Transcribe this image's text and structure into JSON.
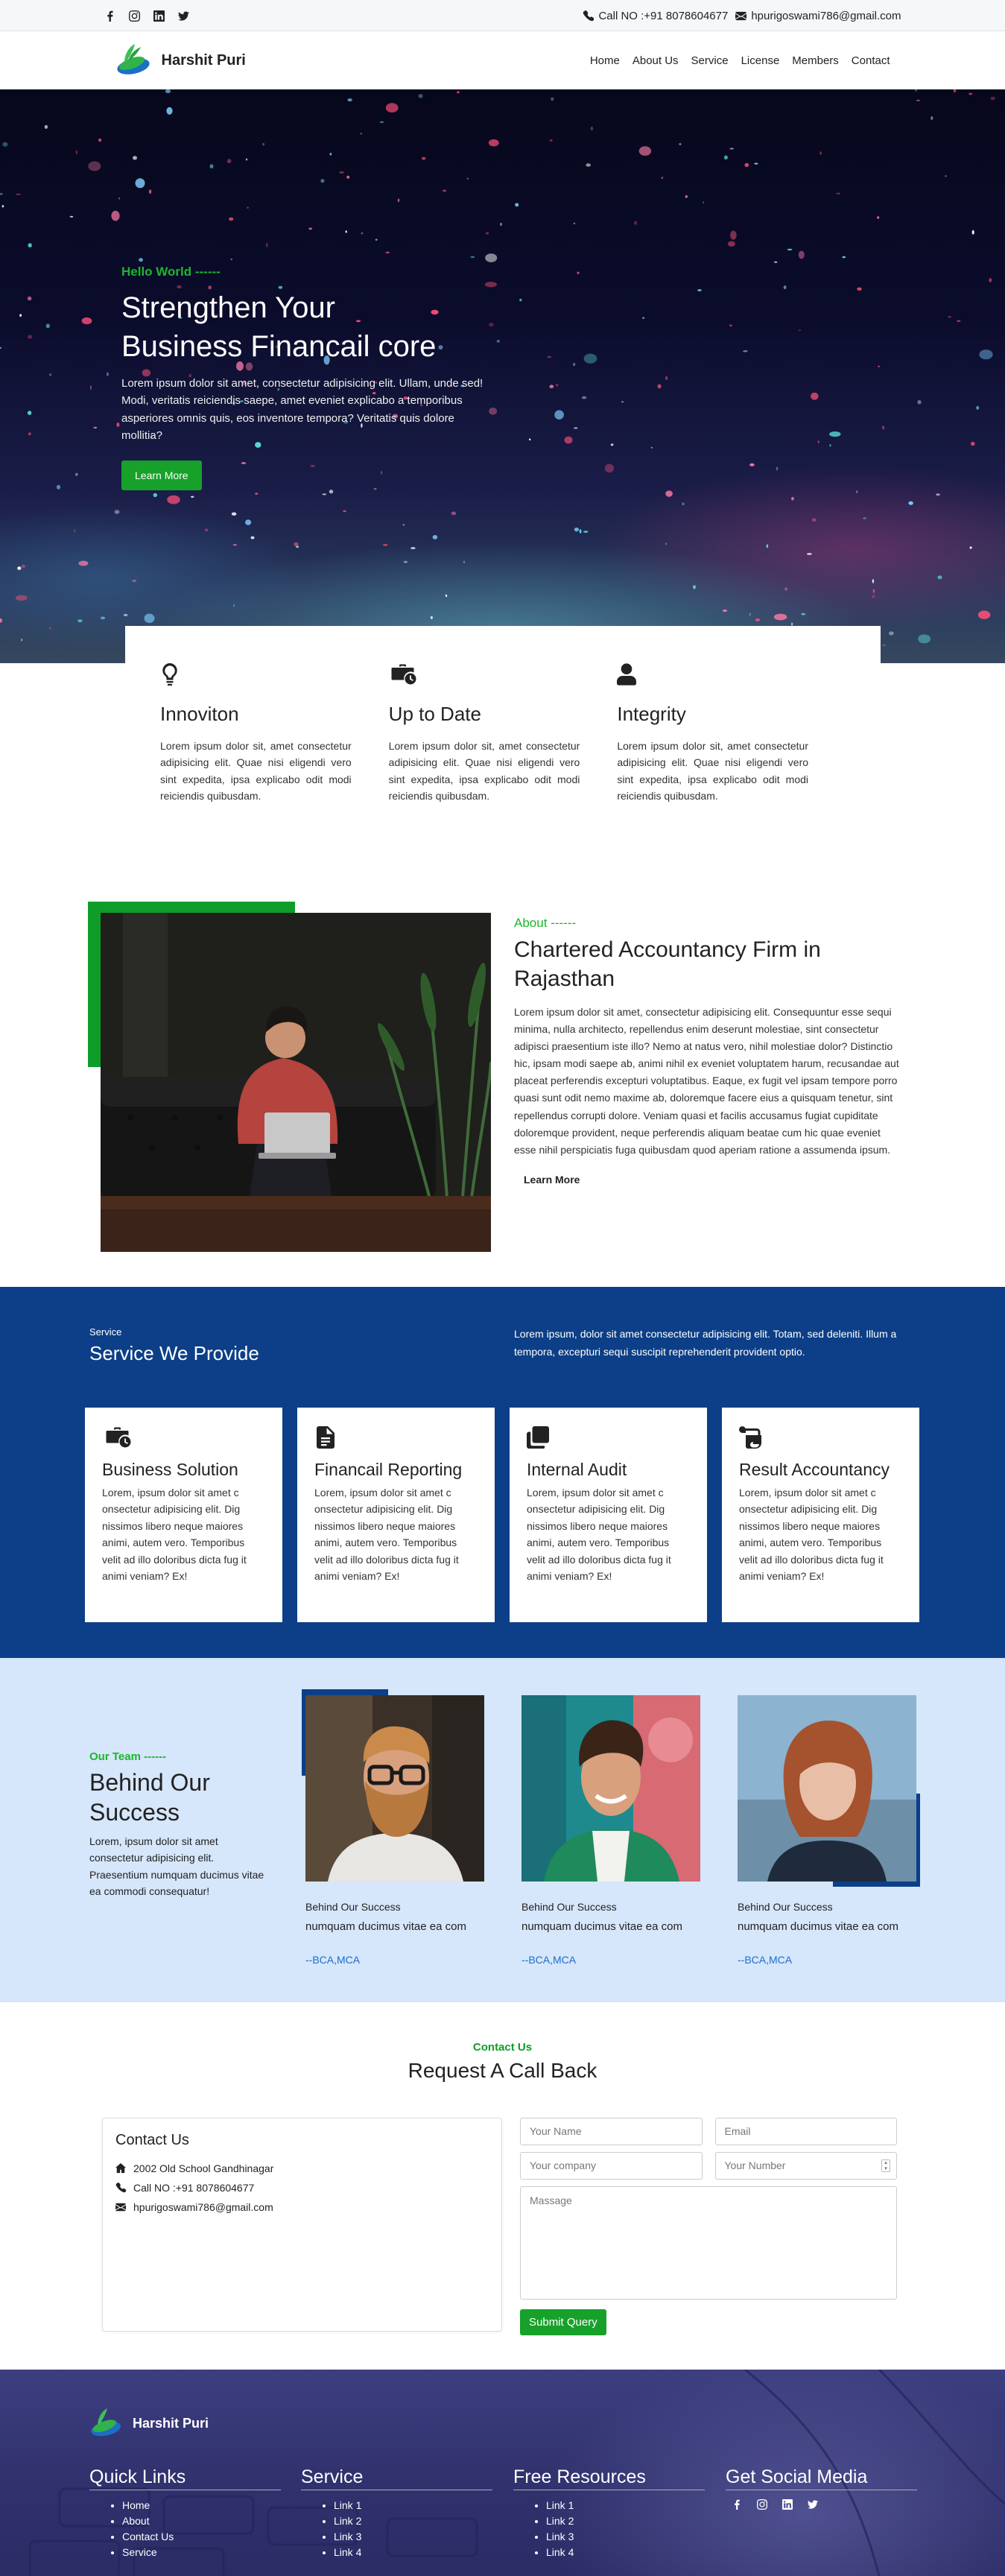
{
  "topbar": {
    "social_icons": [
      "facebook-icon",
      "instagram-icon",
      "linkedin-icon",
      "twitter-icon"
    ],
    "phone": "Call NO :+91 8078604677",
    "email": "hpurigoswami786@gmail.com"
  },
  "nav": {
    "brand": "Harshit Puri",
    "items": [
      "Home",
      "About Us",
      "Service",
      "License",
      "Members",
      "Contact"
    ]
  },
  "hero": {
    "eyebrow": "Hello World ------",
    "title_line1": "Strengthen Your",
    "title_line2": "Business Financail core",
    "text": "Lorem ipsum dolor sit amet, consectetur adipisicing elit. Ullam, unde sed! Modi, veritatis reiciendis saepe, amet eveniet explicabo a temporibus asperiores omnis quis, eos inventore tempora? Veritatis quis dolore mollitia?",
    "button": "Learn More"
  },
  "features": [
    {
      "icon": "lightbulb-icon",
      "title": "Innoviton",
      "text": "Lorem ipsum dolor sit, amet consectetur adipisicing elit. Quae nisi eligendi vero sint expedita, ipsa explicabo odit modi reiciendis quibusdam."
    },
    {
      "icon": "briefcase-clock-icon",
      "title": "Up to Date",
      "text": "Lorem ipsum dolor sit, amet consectetur adipisicing elit. Quae nisi eligendi vero sint expedita, ipsa explicabo odit modi reiciendis quibusdam."
    },
    {
      "icon": "user-icon",
      "title": "Integrity",
      "text": "Lorem ipsum dolor sit, amet consectetur adipisicing elit. Quae nisi eligendi vero sint expedita, ipsa explicabo odit modi reiciendis quibusdam."
    }
  ],
  "about": {
    "eyebrow": "About ------",
    "title": "Chartered Accountancy Firm in Rajasthan",
    "text": "Lorem ipsum dolor sit amet, consectetur adipisicing elit. Consequuntur esse sequi minima, nulla architecto, repellendus enim deserunt molestiae, sint consectetur adipisci praesentium iste illo? Nemo at natus vero, nihil molestiae dolor? Distinctio hic, ipsam modi saepe ab, animi nihil ex eveniet voluptatem harum, recusandae aut placeat perferendis excepturi voluptatibus. Eaque, ex fugit vel ipsam tempore porro quasi sunt odit nemo maxime ab, doloremque facere eius a quisquam tenetur, sint repellendus corrupti dolore. Veniam quasi et facilis accusamus fugiat cupiditate doloremque provident, neque perferendis aliquam beatae cum hic quae eveniet esse nihil perspiciatis fuga quibusdam quod aperiam ratione a assumenda ipsum.",
    "link": "Learn More"
  },
  "services": {
    "small": "Service",
    "title": "Service We Provide",
    "text": "Lorem ipsum, dolor sit amet consectetur adipisicing elit. Totam, sed deleniti. Illum a tempora, excepturi sequi suscipit reprehenderit provident optio.",
    "cards": [
      {
        "icon": "briefcase-clock-icon",
        "title": "Business Solution",
        "text": "Lorem, ipsum dolor sit amet c onsectetur adipisicing elit. Dig nissimos libero neque maiores animi, autem vero. Temporibus velit ad illo doloribus dicta fug it animi veniam? Ex!"
      },
      {
        "icon": "document-icon",
        "title": "Financail Reporting",
        "text": "Lorem, ipsum dolor sit amet c onsectetur adipisicing elit. Dig nissimos libero neque maiores animi, autem vero. Temporibus velit ad illo doloribus dicta fug it animi veniam? Ex!"
      },
      {
        "icon": "copy-icon",
        "title": "Internal Audit",
        "text": "Lorem, ipsum dolor sit amet c onsectetur adipisicing elit. Dig nissimos libero neque maiores animi, autem vero. Temporibus velit ad illo doloribus dicta fug it animi veniam? Ex!"
      },
      {
        "icon": "scroll-icon",
        "title": "Result Accountancy",
        "text": "Lorem, ipsum dolor sit amet c onsectetur adipisicing elit. Dig nissimos libero neque maiores animi, autem vero. Temporibus velit ad illo doloribus dicta fug it animi veniam? Ex!"
      }
    ]
  },
  "team": {
    "eyebrow": "Our Team ------",
    "title": "Behind Our Success",
    "text": "Lorem, ipsum dolor sit amet consectetur adipisicing elit. Praesentium numquam ducimus vitae ea commodi consequatur!",
    "members": [
      {
        "name": "Behind Our Success",
        "desc": "numquam ducimus vitae ea com",
        "qual": "--BCA,MCA"
      },
      {
        "name": "Behind Our Success",
        "desc": "numquam ducimus vitae ea com",
        "qual": "--BCA,MCA"
      },
      {
        "name": "Behind Our Success",
        "desc": "numquam ducimus vitae ea com",
        "qual": "--BCA,MCA"
      }
    ]
  },
  "contact": {
    "eyebrow": "Contact Us",
    "title": "Request A Call Back",
    "box_title": "Contact Us",
    "address": "2002 Old School Gandhinagar",
    "phone": "Call NO :+91 8078604677",
    "email": "hpurigoswami786@gmail.com",
    "placeholders": {
      "name": "Your Name",
      "email": "Email",
      "company": "Your company",
      "number": "Your Number",
      "message": "Massage"
    },
    "submit": "Submit Query"
  },
  "footer": {
    "brand": "Harshit Puri",
    "quick_links": {
      "title": "Quick Links",
      "items": [
        "Home",
        "About",
        "Contact Us",
        "Service"
      ]
    },
    "service": {
      "title": "Service",
      "items": [
        "Link 1",
        "Link 2",
        "Link 3",
        "Link 4"
      ]
    },
    "resources": {
      "title": "Free Resources",
      "items": [
        "Link 1",
        "Link 2",
        "Link 3",
        "Link 4"
      ]
    },
    "social": {
      "title": "Get Social Media",
      "icons": [
        "facebook-icon",
        "instagram-icon",
        "linkedin-icon",
        "twitter-icon"
      ]
    }
  },
  "colors": {
    "accent_green": "#17a12a",
    "brand_blue": "#0c3f87",
    "team_bg": "#d6e6fb"
  }
}
